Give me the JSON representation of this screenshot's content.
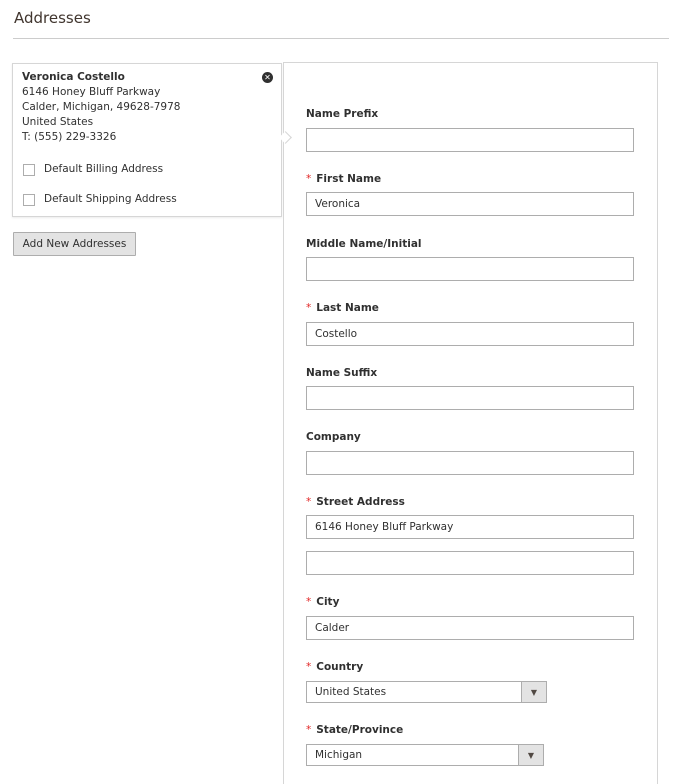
{
  "page": {
    "title": "Addresses"
  },
  "card": {
    "name": "Veronica Costello",
    "street": "6146 Honey Bluff Parkway",
    "city_line": "Calder, Michigan, 49628-7978",
    "country": "United States",
    "phone": "T: (555) 229-3326",
    "remove_icon": "close-circle-icon",
    "default_billing_label": "Default Billing Address",
    "default_shipping_label": "Default Shipping Address",
    "default_billing_checked": false,
    "default_shipping_checked": false
  },
  "add_button": {
    "label": "Add New Addresses"
  },
  "form": {
    "name_prefix": {
      "label": "Name Prefix",
      "value": ""
    },
    "first_name": {
      "label": "First Name",
      "value": "Veronica",
      "required": true
    },
    "middle_name": {
      "label": "Middle Name/Initial",
      "value": ""
    },
    "last_name": {
      "label": "Last Name",
      "value": "Costello",
      "required": true
    },
    "name_suffix": {
      "label": "Name Suffix",
      "value": ""
    },
    "company": {
      "label": "Company",
      "value": ""
    },
    "street": {
      "label": "Street Address",
      "line1": "6146 Honey Bluff Parkway",
      "line2": "",
      "required": true
    },
    "city": {
      "label": "City",
      "value": "Calder",
      "required": true
    },
    "country": {
      "label": "Country",
      "value": "United States",
      "required": true
    },
    "state": {
      "label": "State/Province",
      "value": "Michigan",
      "required": true
    },
    "required_marker": "*"
  },
  "colors": {
    "required": "#e22626",
    "border": "#adadad",
    "button_bg": "#e3e3e3"
  }
}
